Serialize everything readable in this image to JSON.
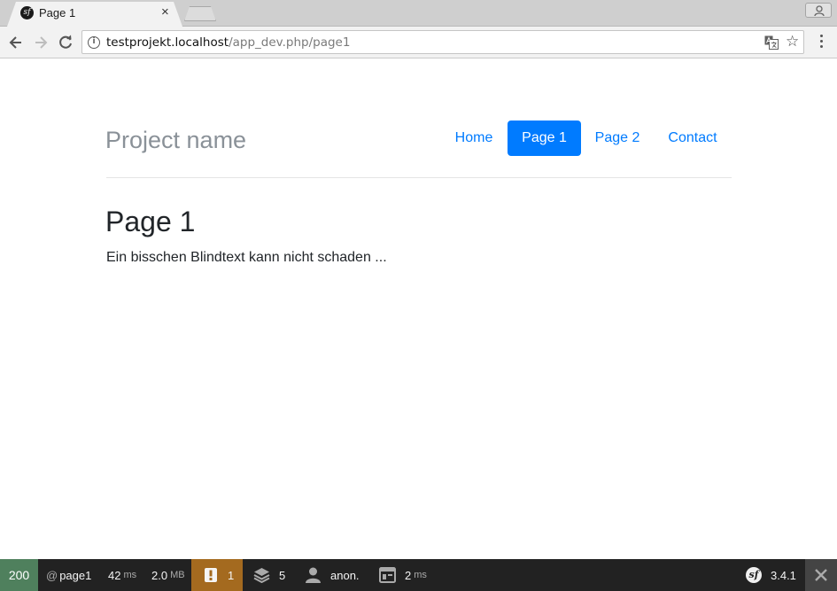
{
  "browser": {
    "tab": {
      "title": "Page 1",
      "close": "×"
    },
    "url": {
      "host": "testprojekt.localhost",
      "path": "/app_dev.php/page1"
    }
  },
  "page": {
    "brand": "Project name",
    "nav": [
      {
        "label": "Home",
        "active": false
      },
      {
        "label": "Page 1",
        "active": true
      },
      {
        "label": "Page 2",
        "active": false
      },
      {
        "label": "Contact",
        "active": false
      }
    ],
    "heading": "Page 1",
    "text": "Ein bisschen Blindtext kann nicht schaden ..."
  },
  "debug_toolbar": {
    "status_code": "200",
    "route_prefix": "@",
    "route": "page1",
    "time": "42",
    "time_unit": "ms",
    "memory": "2.0",
    "memory_unit": "MB",
    "warnings": "1",
    "twig_count": "5",
    "user": "anon.",
    "render_time": "2",
    "render_time_unit": "ms",
    "version": "3.4.1",
    "colors": {
      "status": "#4f805d",
      "warning": "#a46a1f",
      "bar": "#222222"
    }
  },
  "colors": {
    "primary": "#007bff",
    "brand_text": "#8a9198"
  }
}
